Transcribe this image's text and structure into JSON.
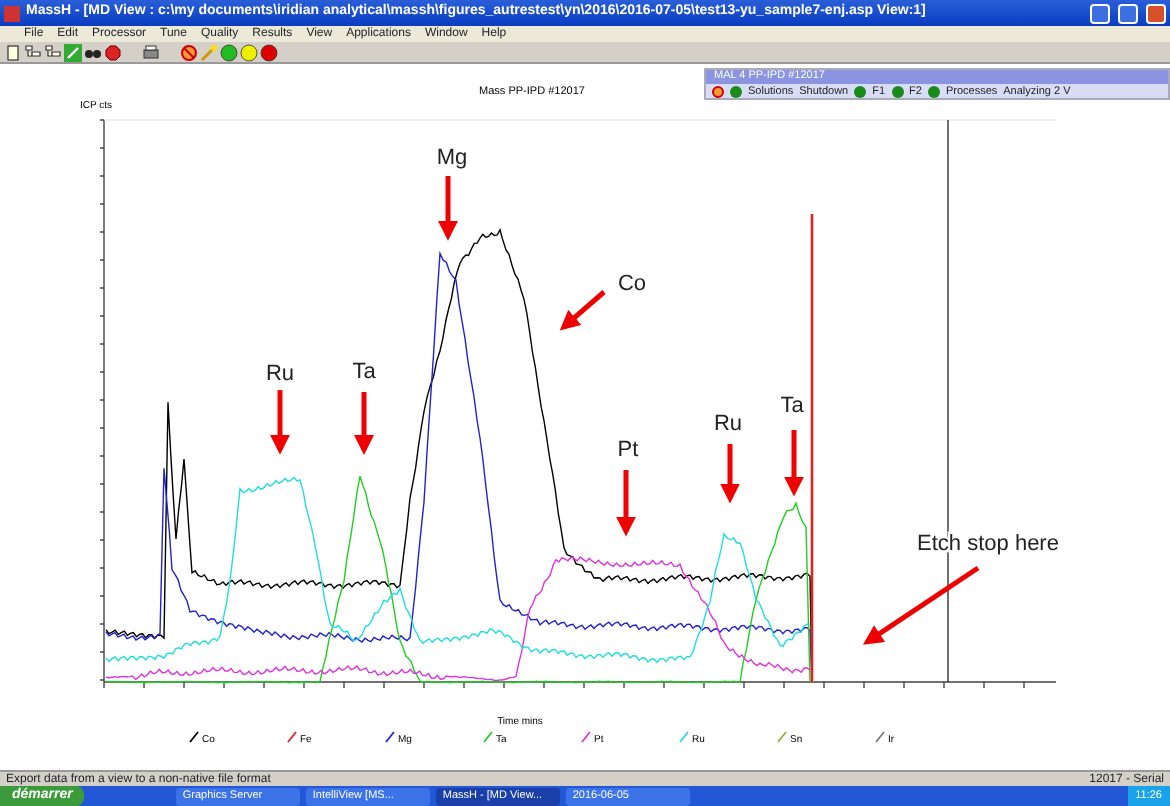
{
  "window": {
    "title": "MassH - [MD View : c:\\my documents\\iridian analytical\\massh\\figures_autrestest\\yn\\2016\\2016-07-05\\test13-yu_sample7-enj.asp View:1]"
  },
  "menu": [
    "File",
    "Edit",
    "Processor",
    "Tune",
    "Quality",
    "Results",
    "View",
    "Applications",
    "Window",
    "Help"
  ],
  "toolbar": [
    {
      "kind": "page"
    },
    {
      "kind": "tree"
    },
    {
      "kind": "tree"
    },
    {
      "kind": "pen"
    },
    {
      "kind": "binoculars"
    },
    {
      "kind": "stop"
    },
    {
      "kind": "gap"
    },
    {
      "kind": "printer"
    },
    {
      "kind": "gap"
    },
    {
      "kind": "nosign"
    },
    {
      "kind": "wand"
    },
    {
      "kind": "light",
      "color": "#22bb22"
    },
    {
      "kind": "light",
      "color": "#eeee00"
    },
    {
      "kind": "light",
      "color": "#dd0000"
    }
  ],
  "instrument_panel": {
    "title": "MAL 4 PP-IPD #12017",
    "items": [
      {
        "label": "Solutions",
        "indicator": true
      },
      {
        "label": "Shutdown",
        "indicator": false
      },
      {
        "label": "F1",
        "indicator": true
      },
      {
        "label": "F2",
        "indicator": true
      },
      {
        "label": "Processes",
        "indicator": true
      },
      {
        "label": "Analyzing 2 V",
        "indicator": false
      }
    ]
  },
  "chart": {
    "title": "Mass PP-IPD #12017",
    "ylabel": "ICP cts",
    "xlabel": "Time mins",
    "annotations": [
      {
        "label": "Mg"
      },
      {
        "label": "Co"
      },
      {
        "label": "Ru"
      },
      {
        "label": "Ta"
      },
      {
        "label": "Pt"
      },
      {
        "label": "Ru"
      },
      {
        "label": "Ta"
      },
      {
        "label": "Etch stop here"
      }
    ],
    "legend": [
      {
        "label": "Co",
        "color": "#000000"
      },
      {
        "label": "Fe",
        "color": "#dd2222"
      },
      {
        "label": "Mg",
        "color": "#2222cc"
      },
      {
        "label": "Ta",
        "color": "#22cc22"
      },
      {
        "label": "Pt",
        "color": "#dd33dd"
      },
      {
        "label": "Ru",
        "color": "#22dddd"
      },
      {
        "label": "Sn",
        "color": "#99aa33"
      },
      {
        "label": "Ir",
        "color": "#777777"
      }
    ]
  },
  "status_bar": {
    "message": "Export data from a view to a non-native file format",
    "right": "12017 - Serial"
  },
  "taskbar": {
    "start": "démarrer",
    "tasks": [
      {
        "label": "Graphics Server",
        "selected": false
      },
      {
        "label": "IntelliView [MS...",
        "selected": false
      },
      {
        "label": "MassH - [MD View...",
        "selected": true
      },
      {
        "label": "2016-06-05",
        "selected": false
      }
    ],
    "clock": "11:26"
  }
}
